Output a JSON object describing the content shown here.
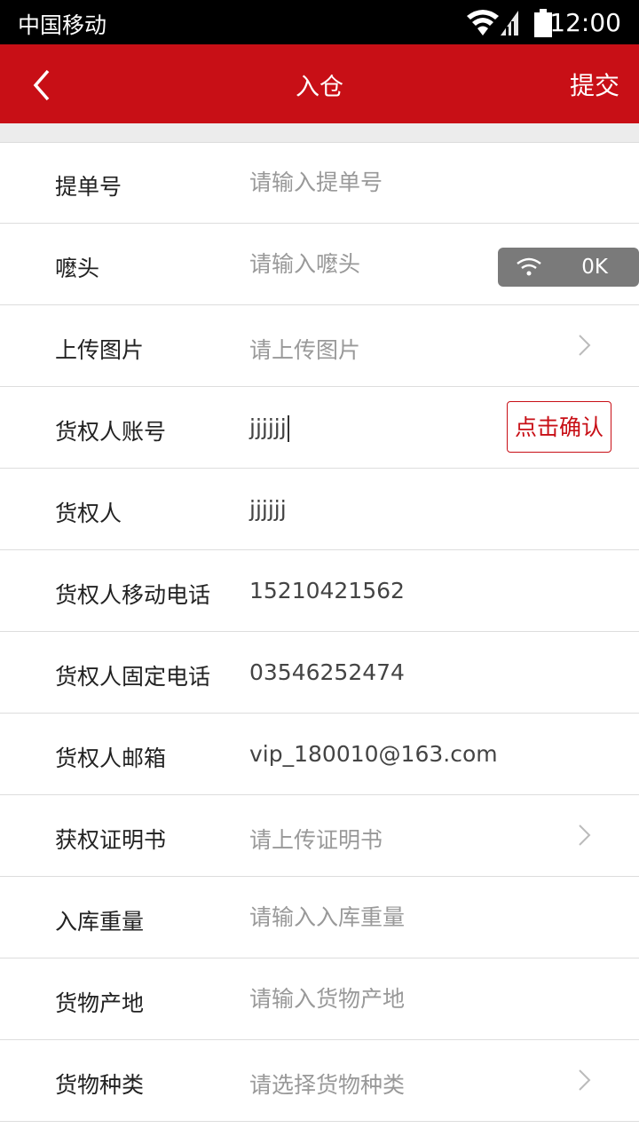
{
  "statusbar": {
    "carrier": "中国移动",
    "time": "12:00"
  },
  "navbar": {
    "title": "入仓",
    "submit": "提交"
  },
  "form": {
    "bill_no": {
      "label": "提单号",
      "placeholder": "请输入提单号",
      "value": ""
    },
    "mark": {
      "label": "嚒头",
      "placeholder": "请输入嚒头",
      "value": ""
    },
    "upload_image": {
      "label": "上传图片",
      "placeholder": "请上传图片"
    },
    "owner_account": {
      "label": "货权人账号",
      "value": "jjjjjj",
      "confirm_label": "点击确认"
    },
    "owner": {
      "label": "货权人",
      "value": "jjjjjj"
    },
    "owner_mobile": {
      "label": "货权人移动电话",
      "value": "15210421562"
    },
    "owner_phone": {
      "label": "货权人固定电话",
      "value": "03546252474"
    },
    "owner_email": {
      "label": "货权人邮箱",
      "value": "vip_180010@163.com"
    },
    "certificate": {
      "label": "获权证明书",
      "placeholder": "请上传证明书"
    },
    "weight": {
      "label": "入库重量",
      "placeholder": "请输入入库重量",
      "value": ""
    },
    "origin": {
      "label": "货物产地",
      "placeholder": "请输入货物产地",
      "value": ""
    },
    "category": {
      "label": "货物种类",
      "placeholder": "请选择货物种类"
    }
  },
  "toast": {
    "text": "0K",
    "icon": "wifi-icon"
  },
  "colors": {
    "brand": "#c80f16",
    "status_bar": "#000000",
    "placeholder": "#999999"
  }
}
